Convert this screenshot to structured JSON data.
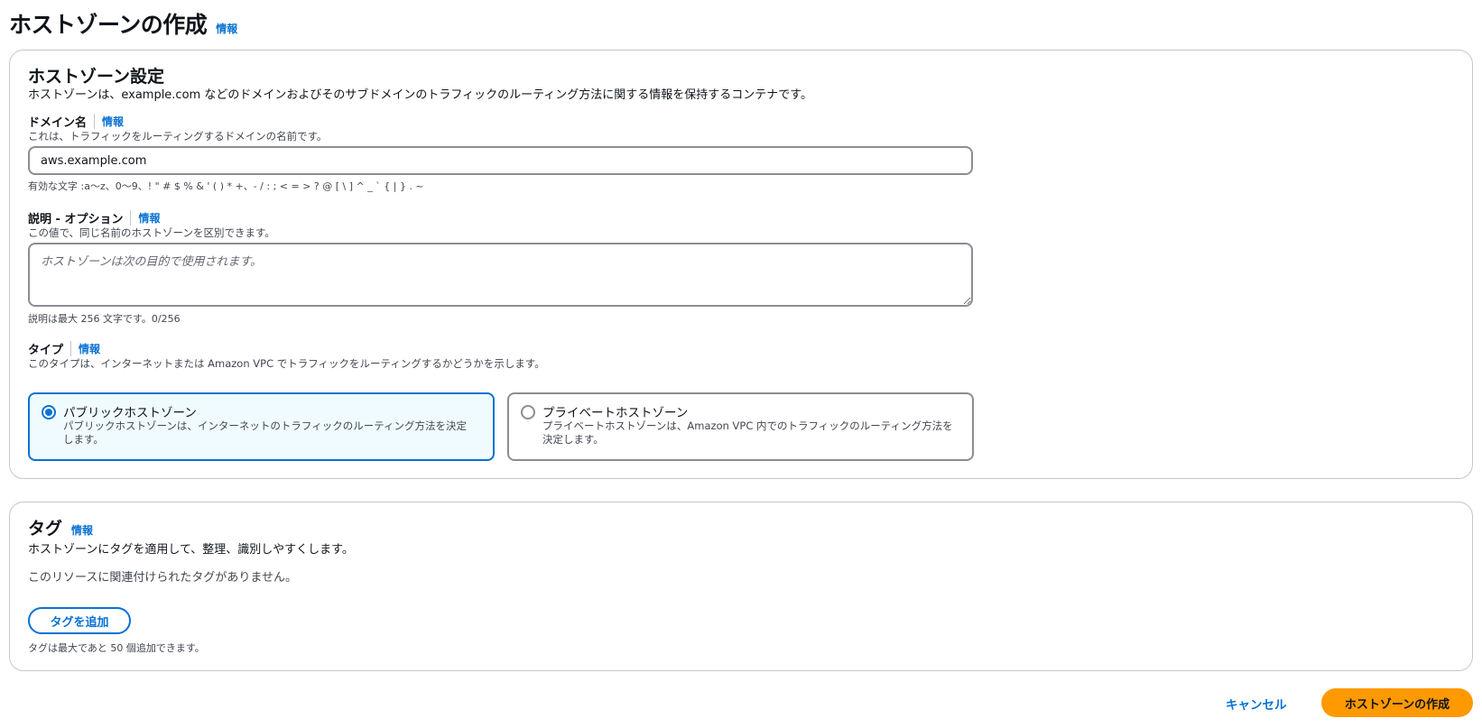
{
  "page": {
    "title": "ホストゾーンの作成",
    "info": "情報"
  },
  "settings": {
    "title": "ホストゾーン設定",
    "info": "情報",
    "description": "ホストゾーンは、example.com などのドメインおよびそのサブドメインのトラフィックのルーティング方法に関する情報を保持するコンテナです。",
    "domain": {
      "label": "ドメイン名",
      "info": "情報",
      "description": "これは、トラフィックをルーティングするドメインの名前です。",
      "value": "aws.example.com",
      "hint": "有効な文字 :a〜z、0〜9、! \" # $ % & ' ( ) * +、- / : ; < = > ? @ [ \\ ] ^ _ ` { | } . ~"
    },
    "comment": {
      "label": "説明 - オプション",
      "info": "情報",
      "description": "この値で、同じ名前のホストゾーンを区別できます。",
      "placeholder": "ホストゾーンは次の目的で使用されます。",
      "value": "",
      "hint": "説明は最大 256 文字です。0/256"
    },
    "type": {
      "label": "タイプ",
      "info": "情報",
      "description": "このタイプは、インターネットまたは Amazon VPC でトラフィックをルーティングするかどうかを示します。",
      "options": [
        {
          "title": "パブリックホストゾーン",
          "description": "パブリックホストゾーンは、インターネットのトラフィックのルーティング方法を決定します。",
          "selected": true
        },
        {
          "title": "プライベートホストゾーン",
          "description": "プライベートホストゾーンは、Amazon VPC 内でのトラフィックのルーティング方法を決定します。",
          "selected": false
        }
      ]
    }
  },
  "tags": {
    "title": "タグ",
    "info": "情報",
    "description": "ホストゾーンにタグを適用して、整理、識別しやすくします。",
    "empty_message": "このリソースに関連付けられたタグがありません。",
    "add_button": "タグを追加",
    "limit_hint": "タグは最大であと 50 個追加できます。"
  },
  "footer": {
    "cancel": "キャンセル",
    "create": "ホストゾーンの作成"
  },
  "colors": {
    "accent": "#0972d3",
    "primary_button": "#ff9900",
    "selected_card_bg": "#f0fbff"
  }
}
